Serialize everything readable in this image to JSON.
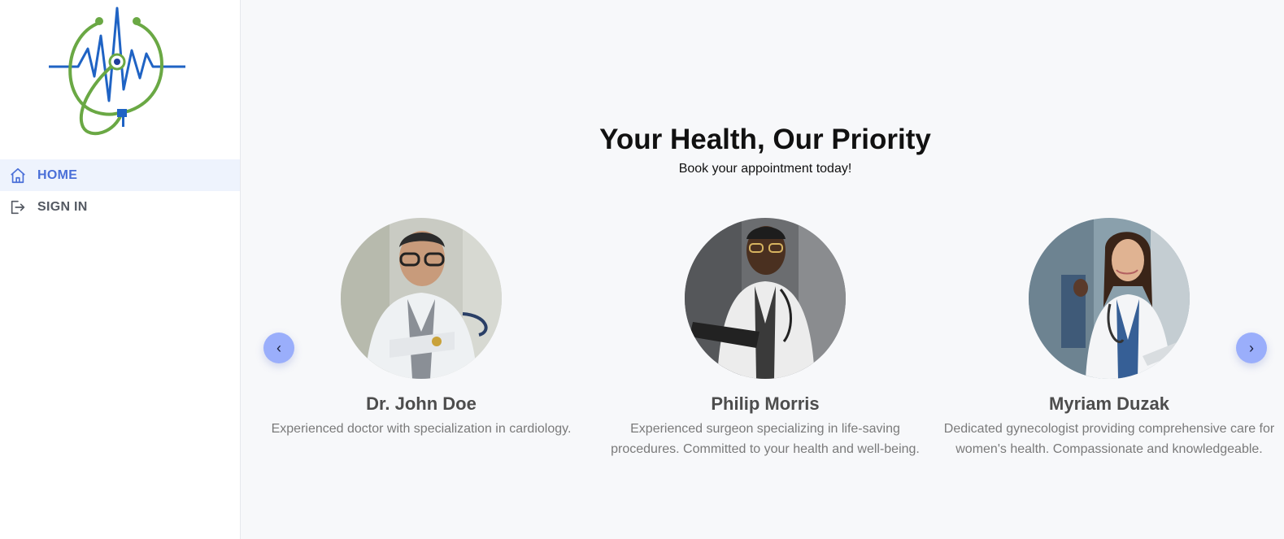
{
  "sidebar": {
    "logo_icon": "stethoscope-heartbeat-logo",
    "items": [
      {
        "label": "HOME",
        "icon": "home-icon",
        "active": true
      },
      {
        "label": "SIGN IN",
        "icon": "sign-in-icon",
        "active": false
      }
    ]
  },
  "hero": {
    "title": "Your Health, Our Priority",
    "subtitle": "Book your appointment today!"
  },
  "carousel": {
    "prev_label": "‹",
    "next_label": "›",
    "doctors": [
      {
        "name": "Dr. John Doe",
        "description": "Experienced doctor with specialization in cardiology."
      },
      {
        "name": "Philip Morris",
        "description": "Experienced surgeon specializing in life-saving procedures. Committed to your health and well-being."
      },
      {
        "name": "Myriam Duzak",
        "description": "Dedicated gynecologist providing comprehensive care for women's health. Compassionate and knowledgeable."
      }
    ]
  },
  "colors": {
    "accent": "#4a6fd8",
    "arrow_bg": "#9aaefb",
    "logo_green": "#6aa844",
    "logo_blue": "#1f63c4"
  }
}
